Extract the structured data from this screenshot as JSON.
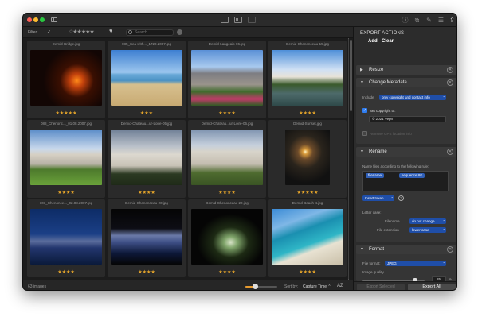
{
  "filterbar": {
    "label": "Filter:",
    "check": "✓",
    "stars": "☆★★★★★",
    "search_placeholder": "Search"
  },
  "grid": {
    "cells": [
      {
        "filename": "Demid-Bridge.jpg",
        "stars": "★★★★★"
      },
      {
        "filename": "085_Sea with..._1720.2007.jpg",
        "stars": "★★★"
      },
      {
        "filename": "Demid-Langeais-06.jpg",
        "stars": "★★★★"
      },
      {
        "filename": "Demid-Chenonceau-15.jpg",
        "stars": "★★★★"
      },
      {
        "filename": "088_Chenonc..._01.08.2007.jpg",
        "stars": "★★★★"
      },
      {
        "filename": "Demid-Chateau...ur-Loire-05.jpg",
        "stars": "★★★★"
      },
      {
        "filename": "Demid-Chateau...ur-Loire-06.jpg",
        "stars": "★★★★"
      },
      {
        "filename": "Demid-Sunset.jpg",
        "stars": "★★★★★"
      },
      {
        "filename": "101_Chenonce..._02.08.2007.jpg",
        "stars": "★★★★"
      },
      {
        "filename": "Demid-Chenonceau-20.jpg",
        "stars": "★★★★"
      },
      {
        "filename": "Demid-Chenonceau 22.jpg",
        "stars": "★★★★"
      },
      {
        "filename": "Demid-Beach-4.jpg",
        "stars": "★★★★"
      }
    ]
  },
  "statusbar": {
    "count": "63 images",
    "zoom_level": 0.3,
    "sort_label": "Sort by:",
    "sort_value": "Capture Time ⌃",
    "sort_dir": "A͟Z"
  },
  "panel": {
    "title": "EXPORT ACTIONS",
    "add": "Add",
    "clear": "Clear",
    "resize": {
      "title": "Resize"
    },
    "metadata": {
      "title": "Change Metadata",
      "include_label": "Include",
      "include_value": "only copyright and contact info",
      "set_copyright_label": "Set copyright to:",
      "copyright_value": "© 2021 VeprIT",
      "remove_gps_label": "Remove GPS location info"
    },
    "rename": {
      "title": "Rename",
      "instruction": "Name files according to the following rule:",
      "token1": "filename",
      "separator": "-",
      "token2": "sequence ##",
      "insert_token": "Insert token",
      "help": "?",
      "letter_case_label": "Letter case:",
      "filename_label": "Filename",
      "filename_value": "do not change",
      "ext_label": "File extension",
      "ext_value": "lower case"
    },
    "format": {
      "title": "Format",
      "file_format_label": "File format:",
      "file_format_value": "JPEG",
      "quality_label": "Image quality",
      "quality_value": "85",
      "quality_unit": "%"
    },
    "export_selected": "Export Selected",
    "export_all": "Export All"
  }
}
